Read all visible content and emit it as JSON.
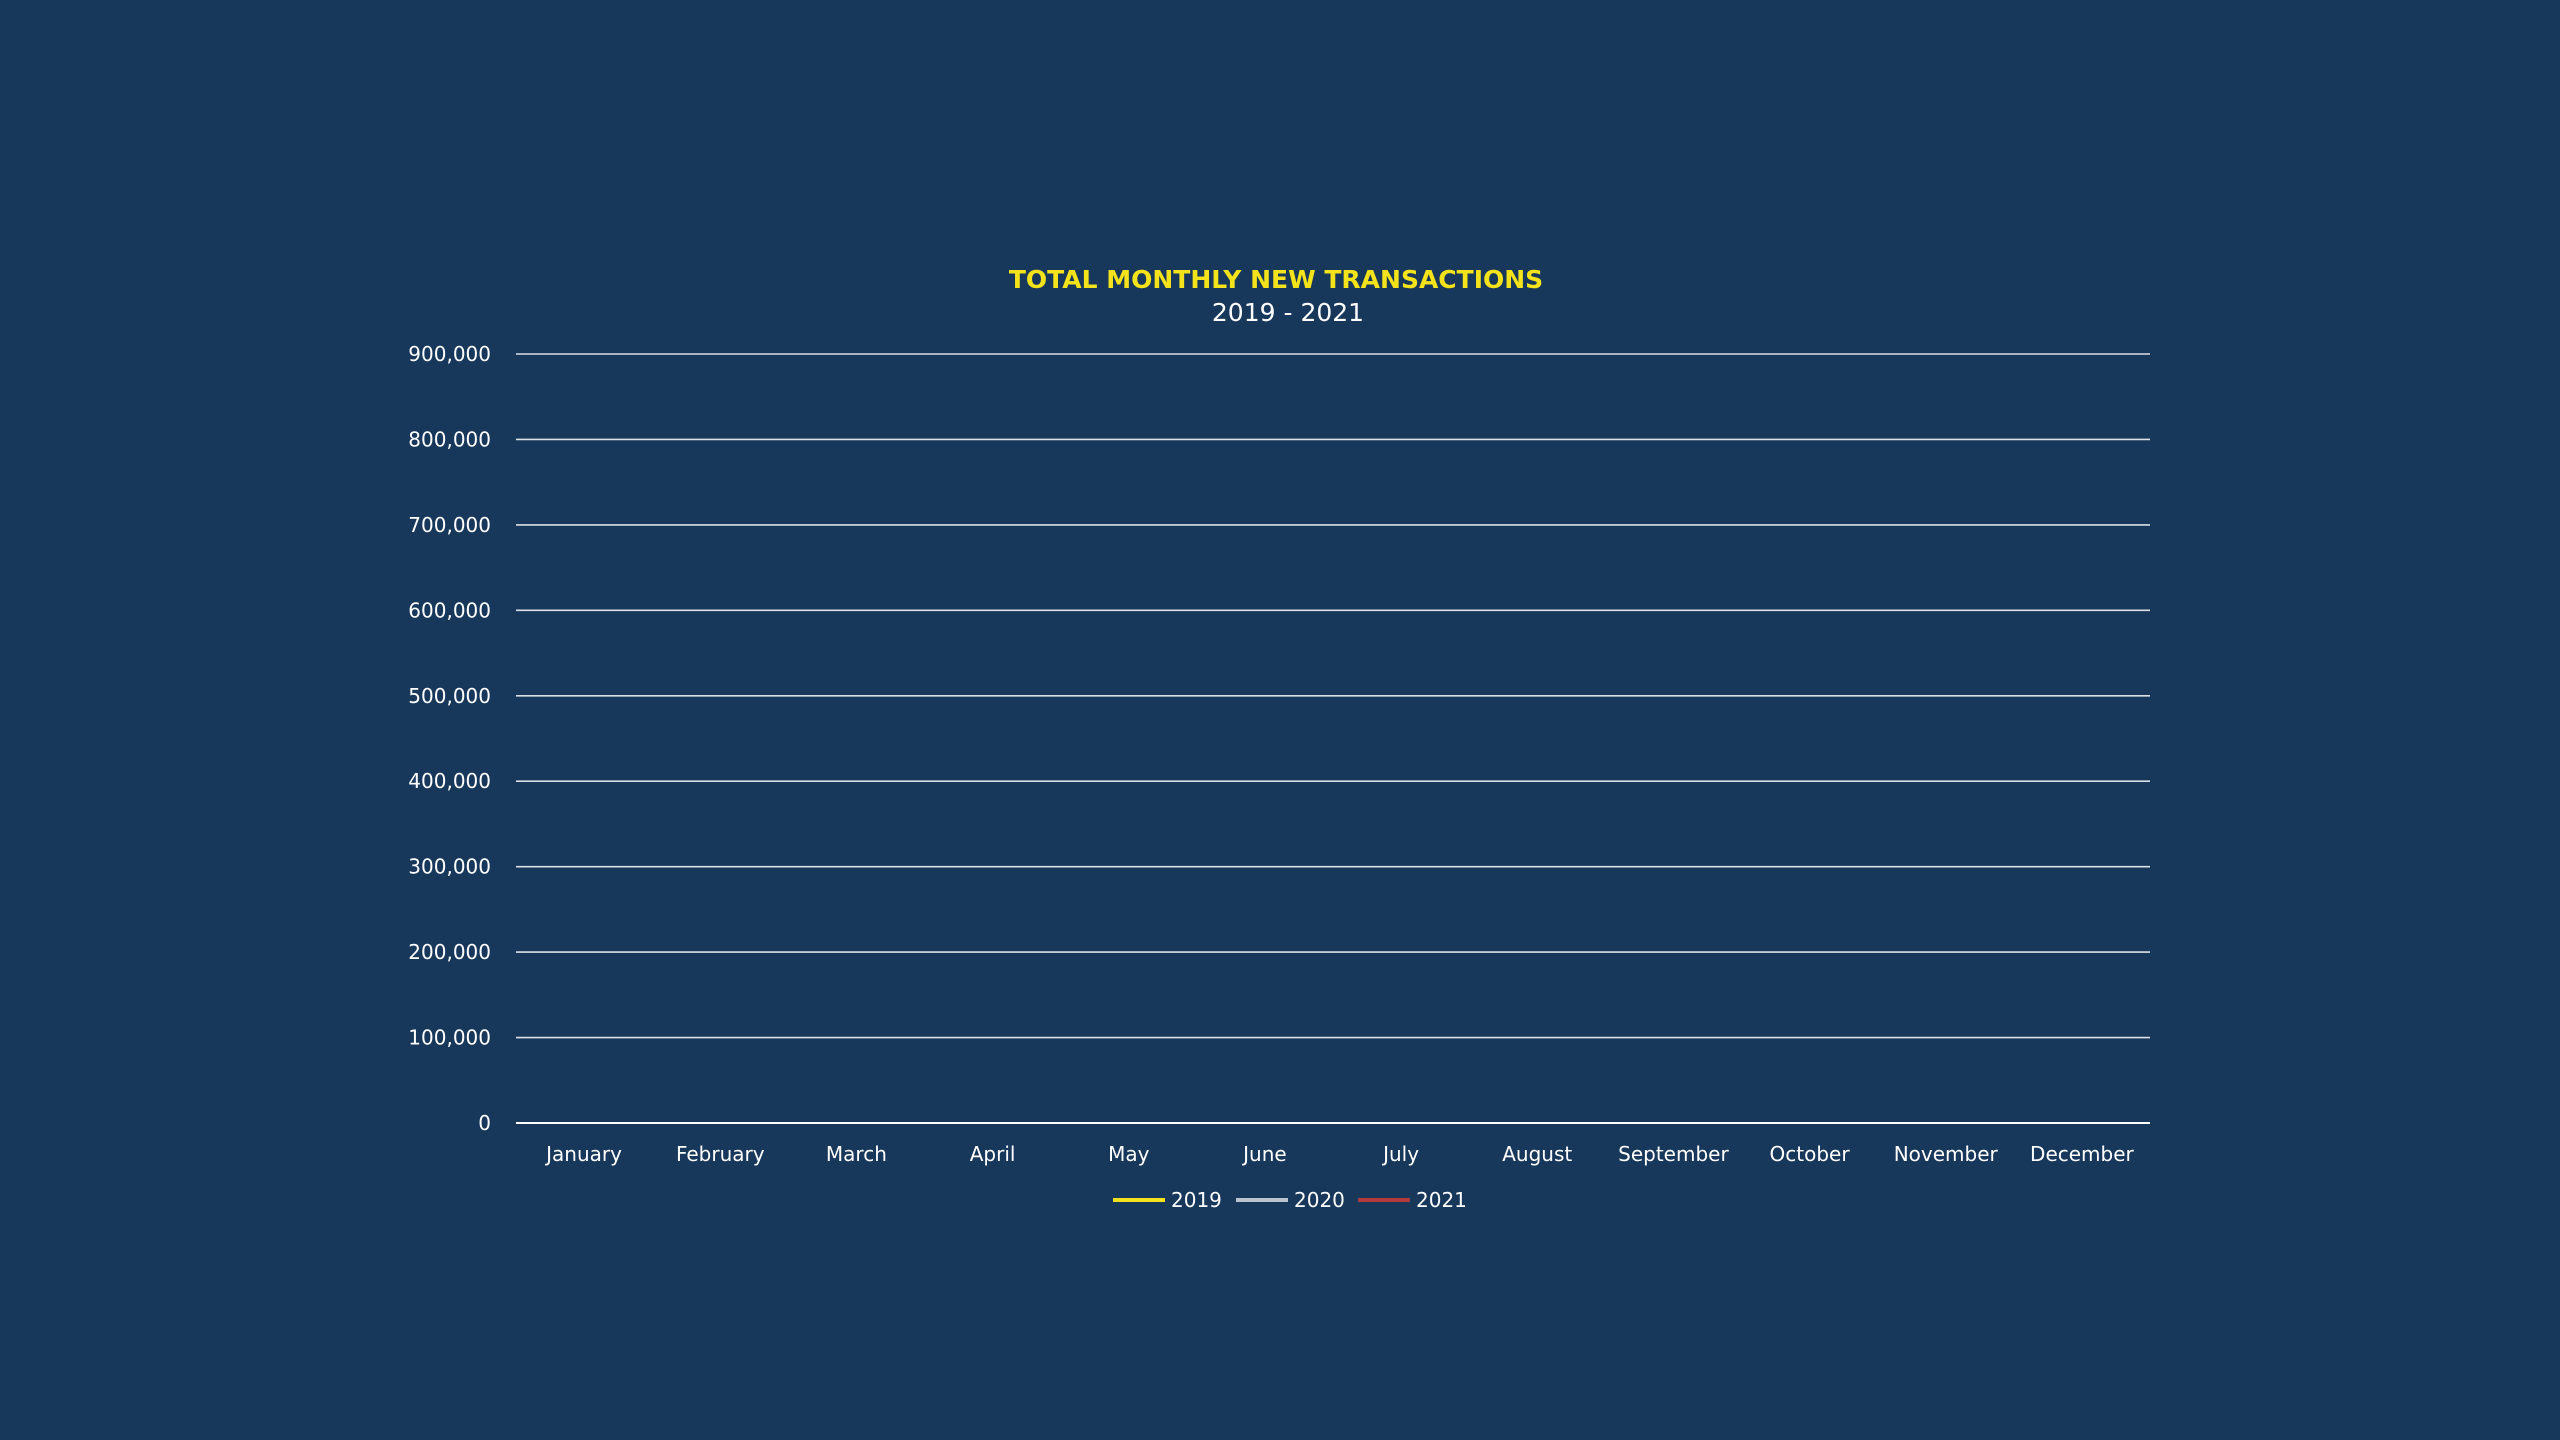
{
  "chart_data": {
    "type": "line",
    "title": "TOTAL MONTHLY NEW TRANSACTIONS",
    "subtitle": "2019 - 2021",
    "categories": [
      "January",
      "February",
      "March",
      "April",
      "May",
      "June",
      "July",
      "August",
      "September",
      "October",
      "November",
      "December"
    ],
    "series": [
      {
        "name": "2019",
        "color": "#f4e31a",
        "values": []
      },
      {
        "name": "2020",
        "color": "#b9c4cf",
        "values": []
      },
      {
        "name": "2021",
        "color": "#b33a3a",
        "values": []
      }
    ],
    "ylim": [
      0,
      900000
    ],
    "yticks": [
      {
        "value": 900000,
        "label": "900,000"
      },
      {
        "value": 800000,
        "label": "800,000"
      },
      {
        "value": 700000,
        "label": "700,000"
      },
      {
        "value": 600000,
        "label": "600,000"
      },
      {
        "value": 500000,
        "label": "500,000"
      },
      {
        "value": 400000,
        "label": "400,000"
      },
      {
        "value": 300000,
        "label": "300,000"
      },
      {
        "value": 200000,
        "label": "200,000"
      },
      {
        "value": 100000,
        "label": "100,000"
      },
      {
        "value": 0,
        "label": "0"
      }
    ],
    "grid": true,
    "legend": "bottom-center",
    "background": "#17375b"
  }
}
